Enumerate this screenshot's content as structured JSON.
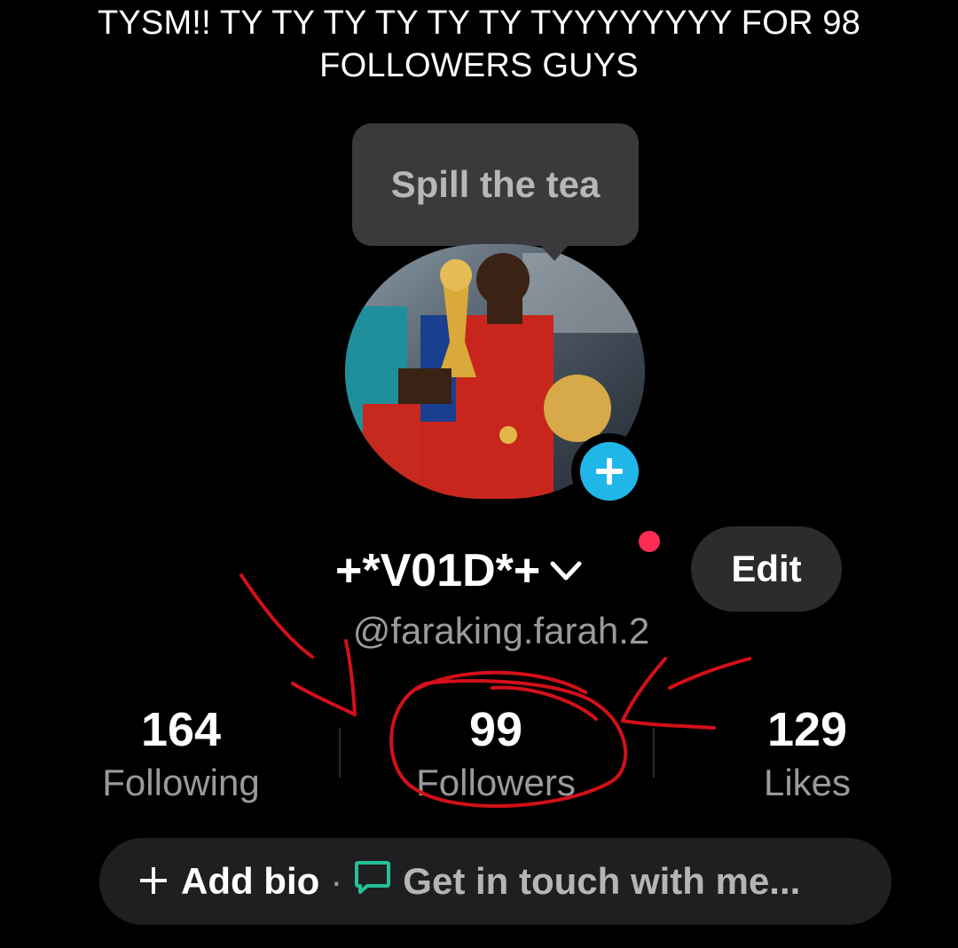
{
  "caption": {
    "line1": "TYSM!! TY TY TY TY TY TY TYYYYYYYY FOR 98",
    "line2": "FOLLOWERS GUYS"
  },
  "tooltip": {
    "text": "Spill the tea"
  },
  "profile": {
    "display_name": "+*V01D*+",
    "username": "@faraking.farah.2",
    "edit_label": "Edit",
    "icons": {
      "avatar_add": "plus-icon",
      "name_switch": "chevron-down-icon",
      "bio_add": "plus-icon",
      "bio_contact": "chat-bubble-icon"
    }
  },
  "stats": [
    {
      "value": "164",
      "label": "Following"
    },
    {
      "value": "99",
      "label": "Followers"
    },
    {
      "value": "129",
      "label": "Likes"
    }
  ],
  "bio_bar": {
    "add_bio_label": "Add bio",
    "separator": "·",
    "contact_text": "Get in touch with me..."
  },
  "colors": {
    "background": "#000000",
    "notification_dot": "#fe2c55",
    "avatar_add_button": "#20b6e8",
    "contact_icon": "#25c196",
    "annotation_red": "#d3101a"
  }
}
